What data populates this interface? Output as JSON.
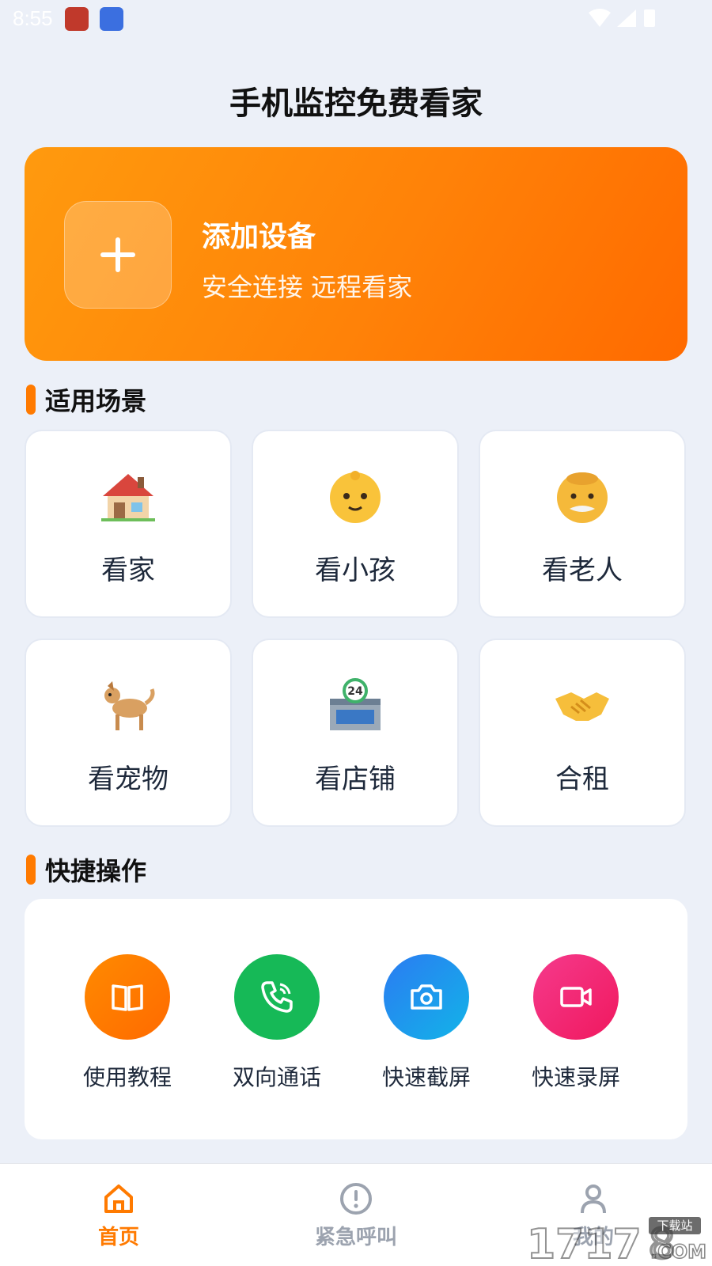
{
  "status": {
    "time": "8:55"
  },
  "page": {
    "title": "手机监控免费看家"
  },
  "hero": {
    "title": "添加设备",
    "subtitle": "安全连接 远程看家"
  },
  "scenes": {
    "heading": "适用场景",
    "items": [
      {
        "label": "看家",
        "icon": "house-icon"
      },
      {
        "label": "看小孩",
        "icon": "baby-face-icon"
      },
      {
        "label": "看老人",
        "icon": "old-man-face-icon"
      },
      {
        "label": "看宠物",
        "icon": "dog-icon"
      },
      {
        "label": "看店铺",
        "icon": "store-24h-icon"
      },
      {
        "label": "合租",
        "icon": "handshake-icon"
      }
    ]
  },
  "quick": {
    "heading": "快捷操作",
    "items": [
      {
        "label": "使用教程",
        "icon": "book-icon",
        "color": "#FF7A00"
      },
      {
        "label": "双向通话",
        "icon": "phone-call-icon",
        "color": "#16B957"
      },
      {
        "label": "快速截屏",
        "icon": "camera-icon",
        "color": "#1E8BF0"
      },
      {
        "label": "快速录屏",
        "icon": "video-icon",
        "color": "#F5287A"
      }
    ]
  },
  "tabs": [
    {
      "label": "首页",
      "icon": "home-icon",
      "active": true,
      "color": "#FF7A00"
    },
    {
      "label": "紧急呼叫",
      "icon": "alert-icon",
      "active": false,
      "color": "#9CA3AF"
    },
    {
      "label": "我的",
      "icon": "user-icon",
      "active": false,
      "color": "#9CA3AF"
    }
  ],
  "watermark": {
    "text": "1717８.COM",
    "badge": "下载站"
  }
}
